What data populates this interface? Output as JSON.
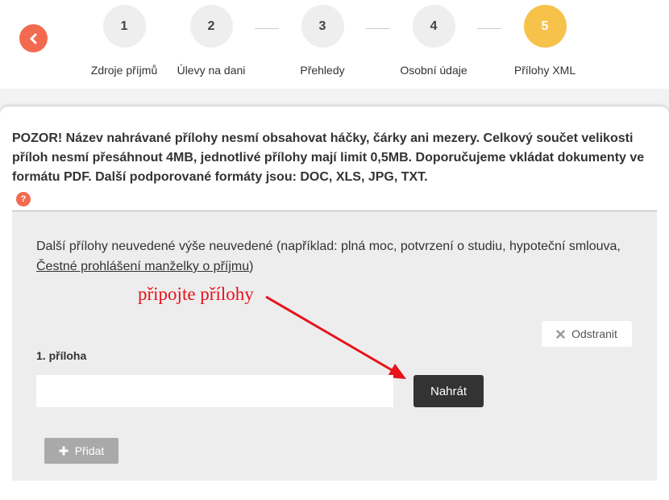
{
  "stepper": {
    "back_icon": "chevron-left-icon",
    "steps": [
      {
        "number": "1",
        "label": "Zdroje příjmů"
      },
      {
        "number": "2",
        "label": "Úlevy na dani"
      },
      {
        "number": "3",
        "label": "Přehledy"
      },
      {
        "number": "4",
        "label": "Osobní údaje"
      },
      {
        "number": "5",
        "label": "Přílohy XML",
        "active": true
      }
    ],
    "colors": {
      "active": "#f6c24a",
      "inactive": "#eeeeee",
      "back": "#f26b50"
    }
  },
  "notice": {
    "warning": "POZOR! Název nahrávané přílohy nesmí obsahovat háčky, čárky ani mezery. Celkový součet velikosti příloh nesmí přesáhnout 4MB, jednotlivé přílohy mají limit 0,5MB. Doporučujeme vkládat dokumenty ve formátu PDF. Další podporované formáty jsou: DOC, XLS, JPG, TXT.",
    "help_glyph": "?"
  },
  "attachments": {
    "description_prefix": "Další přílohy neuvedené výše neuvedené (například: plná moc, potvrzení o studiu, hypoteční smlouva, ",
    "description_link": "Čestné prohlášení manželky o příjmu",
    "description_suffix": ")",
    "annotation": "připojte přílohy",
    "annotation_color": "#e8121b",
    "remove_label": "Odstranit",
    "item_label": "1. příloha",
    "file_value": "",
    "upload_label": "Nahrát",
    "add_label": "Přidat"
  }
}
